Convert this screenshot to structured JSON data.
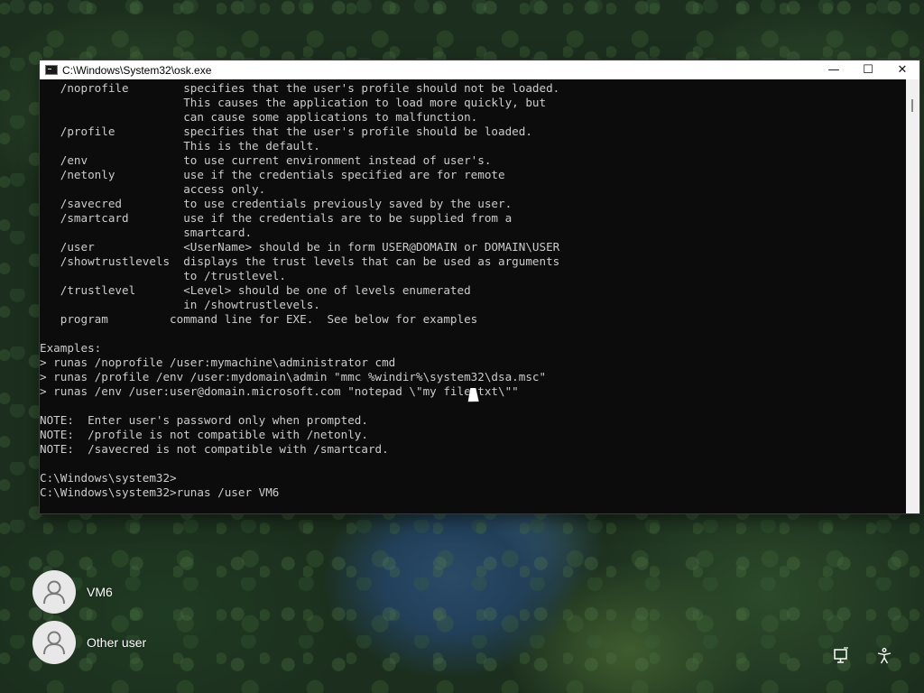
{
  "window": {
    "title": "C:\\Windows\\System32\\osk.exe",
    "minimize_glyph": "—",
    "maximize_glyph": "☐",
    "close_glyph": "✕"
  },
  "console": {
    "lines": [
      "   /noprofile        specifies that the user's profile should not be loaded.",
      "                     This causes the application to load more quickly, but",
      "                     can cause some applications to malfunction.",
      "   /profile          specifies that the user's profile should be loaded.",
      "                     This is the default.",
      "   /env              to use current environment instead of user's.",
      "   /netonly          use if the credentials specified are for remote",
      "                     access only.",
      "   /savecred         to use credentials previously saved by the user.",
      "   /smartcard        use if the credentials are to be supplied from a",
      "                     smartcard.",
      "   /user             <UserName> should be in form USER@DOMAIN or DOMAIN\\USER",
      "   /showtrustlevels  displays the trust levels that can be used as arguments",
      "                     to /trustlevel.",
      "   /trustlevel       <Level> should be one of levels enumerated",
      "                     in /showtrustlevels.",
      "   program         command line for EXE.  See below for examples",
      "",
      "Examples:",
      "> runas /noprofile /user:mymachine\\administrator cmd",
      "> runas /profile /env /user:mydomain\\admin \"mmc %windir%\\system32\\dsa.msc\"",
      "> runas /env /user:user@domain.microsoft.com \"notepad \\\"my file.txt\\\"\"",
      "",
      "NOTE:  Enter user's password only when prompted.",
      "NOTE:  /profile is not compatible with /netonly.",
      "NOTE:  /savecred is not compatible with /smartcard.",
      "",
      "C:\\Windows\\system32>",
      "C:\\Windows\\system32>runas /user VM6"
    ]
  },
  "users": [
    {
      "name": "VM6"
    },
    {
      "name": "Other user"
    }
  ],
  "icons": {
    "network": "network-icon",
    "accessibility": "accessibility-icon"
  }
}
